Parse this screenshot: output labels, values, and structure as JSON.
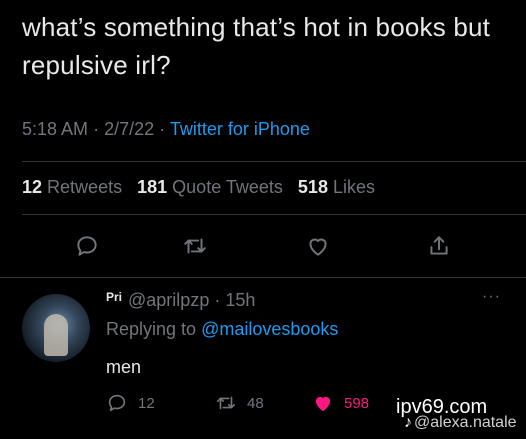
{
  "tweet": {
    "text": "what’s something that’s hot in books but repulsive irl?",
    "time": "5:18 AM",
    "date": "2/7/22",
    "source": "Twitter for iPhone",
    "separator": "·"
  },
  "stats": {
    "retweets_count": "12",
    "retweets_label": "Retweets",
    "quotes_count": "181",
    "quotes_label": "Quote Tweets",
    "likes_count": "518",
    "likes_label": "Likes"
  },
  "reply": {
    "display_name": "Pri",
    "handle": "@aprilpzp",
    "time": "15h",
    "replying_prefix": "Replying to",
    "replying_to": "@mailovesbooks",
    "text": "men",
    "reply_count": "12",
    "retweet_count": "48",
    "like_count": "598",
    "more": "···"
  },
  "watermark": {
    "site": "ipv69.com",
    "tiktok_handle": "@alexa.natale",
    "tiktok_logo": "♪"
  },
  "icons": {
    "reply": "speech-bubble",
    "retweet": "retweet-arrows",
    "like": "heart",
    "share": "share-upload"
  },
  "colors": {
    "background": "#000000",
    "text": "#e7e9ea",
    "muted": "#71767b",
    "accent": "#1d9bf0",
    "like": "#f91880"
  }
}
